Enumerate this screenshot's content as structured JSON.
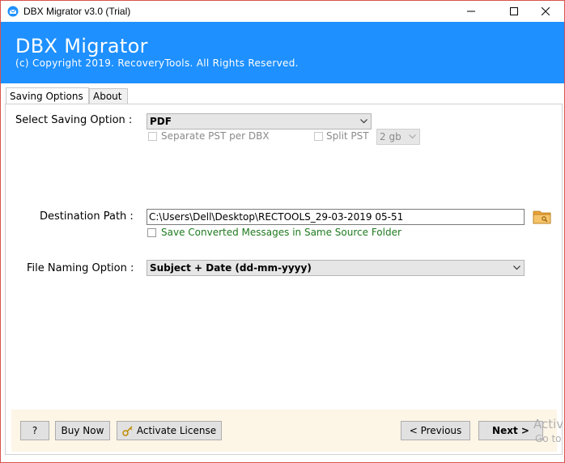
{
  "window": {
    "title": "DBX Migrator v3.0 (Trial)",
    "border_color": "#d9534f"
  },
  "header": {
    "title": "DBX Migrator",
    "copyright": "(c) Copyright 2019. RecoveryTools. All Rights Reserved.",
    "background": "#1e90ff"
  },
  "tabs": [
    {
      "label": "Saving Options",
      "active": true
    },
    {
      "label": "About",
      "active": false
    }
  ],
  "saving": {
    "label": "Select Saving Option :",
    "selected": "PDF",
    "separate_pst_label": "Separate PST per DBX",
    "split_pst_label": "Split PST",
    "split_size": "2 gb"
  },
  "destination": {
    "label": "Destination Path :",
    "value": "C:\\Users\\Dell\\Desktop\\RECTOOLS_29-03-2019 05-51",
    "save_same_folder_label": "Save Converted Messages in Same Source Folder"
  },
  "naming": {
    "label": "File Naming Option :",
    "selected": "Subject + Date (dd-mm-yyyy)"
  },
  "footer": {
    "help_label": "?",
    "buy_label": "Buy Now",
    "activate_label": "Activate License",
    "previous_label": "< Previous",
    "next_label": "Next >",
    "watermark_line1": "Activ",
    "watermark_line2": "Go to"
  }
}
